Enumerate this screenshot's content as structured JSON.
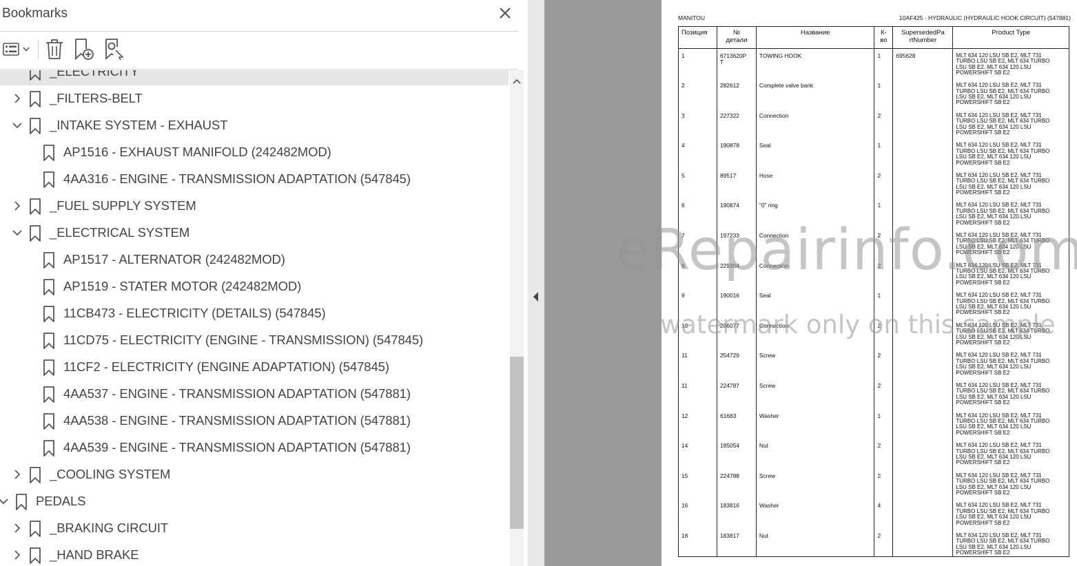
{
  "bookmarks_panel": {
    "title": "Bookmarks",
    "items": [
      {
        "label": "_ELECTRICITY",
        "level": 1,
        "expanded": null,
        "selected": true
      },
      {
        "label": "_FILTERS-BELT",
        "level": 1,
        "expanded": false
      },
      {
        "label": "_INTAKE SYSTEM - EXHAUST",
        "level": 1,
        "expanded": true
      },
      {
        "label": "AP1516 - EXHAUST MANIFOLD (242482MOD)",
        "level": 2
      },
      {
        "label": "4AA316 - ENGINE - TRANSMISSION ADAPTATION (547845)",
        "level": 2
      },
      {
        "label": "_FUEL SUPPLY SYSTEM",
        "level": 1,
        "expanded": false
      },
      {
        "label": "_ELECTRICAL SYSTEM",
        "level": 1,
        "expanded": true
      },
      {
        "label": "AP1517 - ALTERNATOR (242482MOD)",
        "level": 2
      },
      {
        "label": "AP1519 - STATER MOTOR (242482MOD)",
        "level": 2
      },
      {
        "label": "11CB473 - ELECTRICITY (DETAILS) (547845)",
        "level": 2
      },
      {
        "label": "11CD75 - ELECTRICITY (ENGINE - TRANSMISSION) (547845)",
        "level": 2
      },
      {
        "label": "11CF2 - ELECTRICITY (ENGINE ADAPTATION) (547845)",
        "level": 2
      },
      {
        "label": "4AA537 - ENGINE - TRANSMISSION ADAPTATION (547881)",
        "level": 2
      },
      {
        "label": "4AA538 - ENGINE - TRANSMISSION ADAPTATION (547881)",
        "level": 2
      },
      {
        "label": "4AA539 - ENGINE - TRANSMISSION ADAPTATION (547881)",
        "level": 2
      },
      {
        "label": "_COOLING SYSTEM",
        "level": 1,
        "expanded": false
      },
      {
        "label": "PEDALS",
        "level": 0,
        "expanded": true
      },
      {
        "label": "_BRAKING CIRCUIT",
        "level": 1,
        "expanded": false
      },
      {
        "label": "_HAND BRAKE",
        "level": 1,
        "expanded": false
      }
    ]
  },
  "document": {
    "header_left": "MANITOU",
    "header_right": "10AF425 - HYDRAULIC (HYDRAULIC HOOK CIRCUIT) (547881)",
    "columns": [
      "Позиция",
      "№ детали",
      "Название",
      "К-во",
      "SupersededPartNumber",
      "Product Type"
    ],
    "columns_display": [
      "Позиция",
      "№\nдетали",
      "Название",
      "К-\nво",
      "SupersededPa\nrtNumber",
      "Product Type"
    ],
    "rows": [
      {
        "pos": "1",
        "num": "6713620P\nT",
        "name": "TOWING HOOK",
        "qty": "1",
        "sup": "695628",
        "prod": "MLT 634 120 LSU SB E2, MLT 731\nTURBO LSU SB E2, MLT 634 TURBO\nLSU SB E2, MLT 634 120 LSU\nPOWERSHIFT SB E2"
      },
      {
        "pos": "2",
        "num": "282612",
        "name": "Complete valve bank",
        "qty": "1",
        "sup": "",
        "prod": "MLT 634 120 LSU SB E2, MLT 731\nTURBO LSU SB E2, MLT 634 TURBO\nLSU SB E2, MLT 634 120 LSU\nPOWERSHIFT SB E2"
      },
      {
        "pos": "3",
        "num": "227322",
        "name": "Connection",
        "qty": "2",
        "sup": "",
        "prod": "MLT 634 120 LSU SB E2, MLT 731\nTURBO LSU SB E2, MLT 634 TURBO\nLSU SB E2, MLT 634 120 LSU\nPOWERSHIFT SB E2"
      },
      {
        "pos": "4",
        "num": "190878",
        "name": "Seal",
        "qty": "1",
        "sup": "",
        "prod": "MLT 634 120 LSU SB E2, MLT 731\nTURBO LSU SB E2, MLT 634 TURBO\nLSU SB E2, MLT 634 120 LSU\nPOWERSHIFT SB E2"
      },
      {
        "pos": "5",
        "num": "89517",
        "name": "Hose",
        "qty": "2",
        "sup": "",
        "prod": "MLT 634 120 LSU SB E2, MLT 731\nTURBO LSU SB E2, MLT 634 TURBO\nLSU SB E2, MLT 634 120 LSU\nPOWERSHIFT SB E2"
      },
      {
        "pos": "6",
        "num": "190874",
        "name": "\"0\" ring",
        "qty": "1",
        "sup": "",
        "prod": "MLT 634 120 LSU SB E2, MLT 731\nTURBO LSU SB E2, MLT 634 TURBO\nLSU SB E2, MLT 634 120 LSU\nPOWERSHIFT SB E2"
      },
      {
        "pos": "7",
        "num": "197233",
        "name": "Connection",
        "qty": "2",
        "sup": "",
        "prod": "MLT 634 120 LSU SB E2, MLT 731\nTURBO LSU SB E2, MLT 634 TURBO\nLSU SB E2, MLT 634 120 LSU\nPOWERSHIFT SB E2"
      },
      {
        "pos": "8",
        "num": "229364",
        "name": "Connection",
        "qty": "2",
        "sup": "",
        "prod": "MLT 634 120 LSU SB E2, MLT 731\nTURBO LSU SB E2, MLT 634 TURBO\nLSU SB E2, MLT 634 120 LSU\nPOWERSHIFT SB E2"
      },
      {
        "pos": "9",
        "num": "190016",
        "name": "Seal",
        "qty": "1",
        "sup": "",
        "prod": "MLT 634 120 LSU SB E2, MLT 731\nTURBO LSU SB E2, MLT 634 TURBO\nLSU SB E2, MLT 634 120 LSU\nPOWERSHIFT SB E2"
      },
      {
        "pos": "10",
        "num": "206077",
        "name": "Connection",
        "qty": "2",
        "sup": "",
        "prod": "MLT 634 120 LSU SB E2, MLT 731\nTURBO LSU SB E2, MLT 634 TURBO\nLSU SB E2, MLT 634 120 LSU\nPOWERSHIFT SB E2"
      },
      {
        "pos": "11",
        "num": "254729",
        "name": "Screw",
        "qty": "2",
        "sup": "",
        "prod": "MLT 634 120 LSU SB E2, MLT 731\nTURBO LSU SB E2, MLT 634 TURBO\nLSU SB E2, MLT 634 120 LSU\nPOWERSHIFT SB E2"
      },
      {
        "pos": "11",
        "num": "224787",
        "name": "Screw",
        "qty": "2",
        "sup": "",
        "prod": "MLT 634 120 LSU SB E2, MLT 731\nTURBO LSU SB E2, MLT 634 TURBO\nLSU SB E2, MLT 634 120 LSU\nPOWERSHIFT SB E2"
      },
      {
        "pos": "12",
        "num": "61683",
        "name": "Washer",
        "qty": "1",
        "sup": "",
        "prod": "MLT 634 120 LSU SB E2, MLT 731\nTURBO LSU SB E2, MLT 634 TURBO\nLSU SB E2, MLT 634 120 LSU\nPOWERSHIFT SB E2"
      },
      {
        "pos": "14",
        "num": "185054",
        "name": "Nut",
        "qty": "2",
        "sup": "",
        "prod": "MLT 634 120 LSU SB E2, MLT 731\nTURBO LSU SB E2, MLT 634 TURBO\nLSU SB E2, MLT 634 120 LSU\nPOWERSHIFT SB E2"
      },
      {
        "pos": "15",
        "num": "224788",
        "name": "Screw",
        "qty": "2",
        "sup": "",
        "prod": "MLT 634 120 LSU SB E2, MLT 731\nTURBO LSU SB E2, MLT 634 TURBO\nLSU SB E2, MLT 634 120 LSU\nPOWERSHIFT SB E2"
      },
      {
        "pos": "16",
        "num": "183816",
        "name": "Washer",
        "qty": "4",
        "sup": "",
        "prod": "MLT 634 120 LSU SB E2, MLT 731\nTURBO LSU SB E2, MLT 634 TURBO\nLSU SB E2, MLT 634 120 LSU\nPOWERSHIFT SB E2"
      },
      {
        "pos": "18",
        "num": "183817",
        "name": "Nut",
        "qty": "2",
        "sup": "",
        "prod": "MLT 634 120 LSU SB E2, MLT 731\nTURBO LSU SB E2, MLT 634 TURBO\nLSU SB E2, MLT 634 120 LSU\nPOWERSHIFT SB E2"
      }
    ]
  },
  "watermark": {
    "main": "eRepairinfo.com",
    "sub": "watermark only on this sample"
  },
  "colors": {
    "panel_text": "#444444",
    "selected_row": "#e6e6e6",
    "viewer_background": "#9a9a9a",
    "scroll_thumb": "#c1c1c1"
  }
}
